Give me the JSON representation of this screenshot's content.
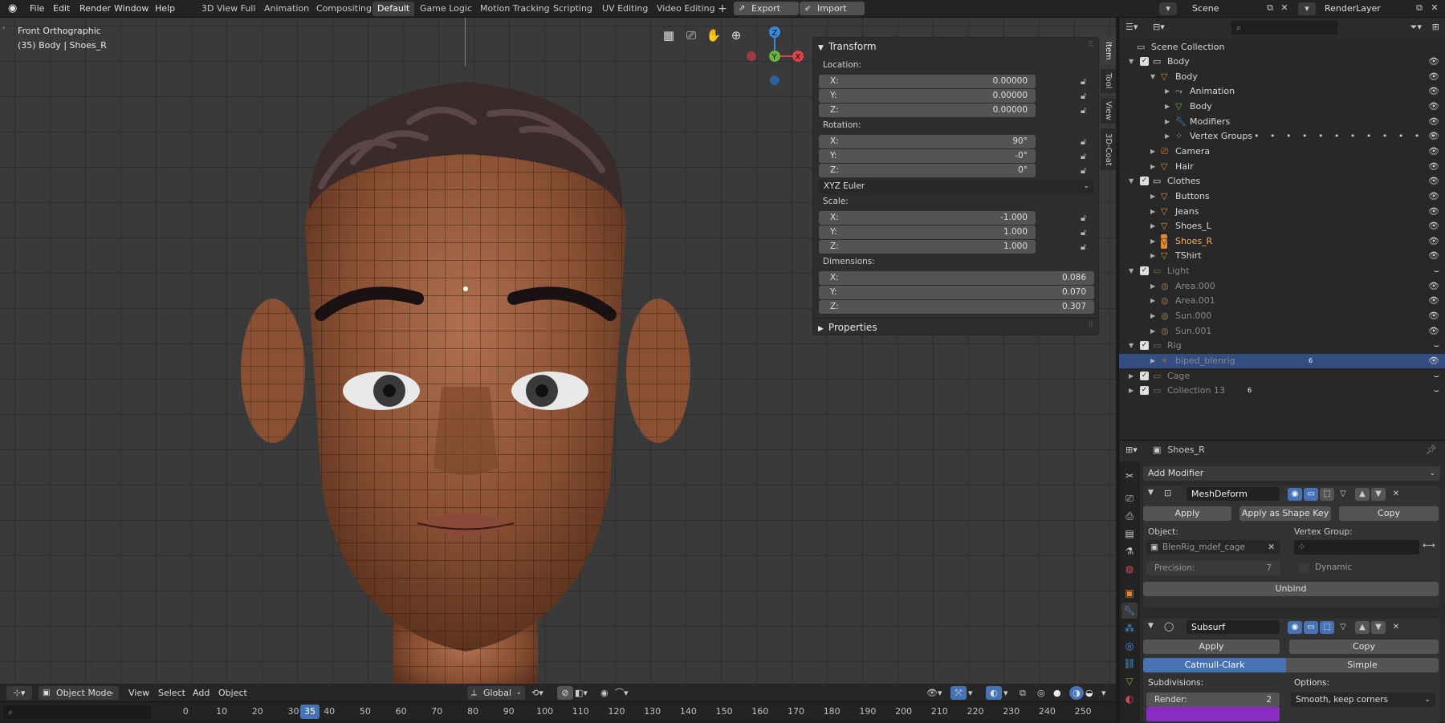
{
  "topbar": {
    "menus": [
      "File",
      "Edit",
      "Render",
      "Window",
      "Help"
    ],
    "workspaces": [
      "3D View Full",
      "Animation",
      "Compositing",
      "Default",
      "Game Logic",
      "Motion Tracking",
      "Scripting",
      "UV Editing",
      "Video Editing"
    ],
    "active_workspace": "Default",
    "add_tab": "+",
    "export_label": "Export",
    "import_label": "Import",
    "scene_name": "Scene",
    "render_layer": "RenderLayer"
  },
  "viewport": {
    "view_name": "Front Orthographic",
    "object_info": "(35) Body | Shoes_R",
    "gizmo": {
      "z": "Z",
      "y": "Y",
      "x": "X"
    },
    "accent_red": "#e0414b",
    "accent_green": "#6ab43c",
    "accent_blue": "#3a8be0"
  },
  "npanel": {
    "transform_title": "Transform",
    "location_label": "Location:",
    "location": [
      {
        "k": "X:",
        "v": "0.00000"
      },
      {
        "k": "Y:",
        "v": "0.00000"
      },
      {
        "k": "Z:",
        "v": "0.00000"
      }
    ],
    "rotation_label": "Rotation:",
    "rotation": [
      {
        "k": "X:",
        "v": "90°"
      },
      {
        "k": "Y:",
        "v": "-0°"
      },
      {
        "k": "Z:",
        "v": "0°"
      }
    ],
    "rotation_mode": "XYZ Euler",
    "scale_label": "Scale:",
    "scale": [
      {
        "k": "X:",
        "v": "-1.000"
      },
      {
        "k": "Y:",
        "v": "1.000"
      },
      {
        "k": "Z:",
        "v": "1.000"
      }
    ],
    "dimensions_label": "Dimensions:",
    "dimensions": [
      {
        "k": "X:",
        "v": "0.086"
      },
      {
        "k": "Y:",
        "v": "0.070"
      },
      {
        "k": "Z:",
        "v": "0.307"
      }
    ],
    "properties_title": "Properties",
    "tabs": [
      "Item",
      "Tool",
      "View",
      "3D-Coat"
    ]
  },
  "viewport_header": {
    "mode": "Object Mode",
    "menus": [
      "View",
      "Select",
      "Add",
      "Object"
    ],
    "orientation": "Global"
  },
  "timeline": {
    "current_frame": "35",
    "ticks": [
      "0",
      "10",
      "20",
      "30",
      "40",
      "50",
      "60",
      "70",
      "80",
      "90",
      "100",
      "110",
      "120",
      "130",
      "140",
      "150",
      "160",
      "170",
      "180",
      "190",
      "200",
      "210",
      "220",
      "230",
      "240",
      "250"
    ]
  },
  "outliner": {
    "root": "Scene Collection",
    "rows": [
      {
        "label": "Body",
        "level": 1,
        "type": "collection"
      },
      {
        "label": "Body",
        "level": 2,
        "type": "object"
      },
      {
        "label": "Animation",
        "level": 3,
        "type": "anim"
      },
      {
        "label": "Body",
        "level": 3,
        "type": "mesh"
      },
      {
        "label": "Modifiers",
        "level": 3,
        "type": "mod"
      },
      {
        "label": "Vertex Groups",
        "level": 3,
        "type": "vg"
      },
      {
        "label": "Camera",
        "level": 2,
        "type": "camera"
      },
      {
        "label": "Hair",
        "level": 2,
        "type": "object"
      },
      {
        "label": "Clothes",
        "level": 1,
        "type": "collection"
      },
      {
        "label": "Buttons",
        "level": 2,
        "type": "object"
      },
      {
        "label": "Jeans",
        "level": 2,
        "type": "object"
      },
      {
        "label": "Shoes_L",
        "level": 2,
        "type": "object"
      },
      {
        "label": "Shoes_R",
        "level": 2,
        "type": "object",
        "active": true
      },
      {
        "label": "TShirt",
        "level": 2,
        "type": "object"
      },
      {
        "label": "Light",
        "level": 1,
        "type": "collection",
        "dim": true
      },
      {
        "label": "Area.000",
        "level": 2,
        "type": "light",
        "dim": true
      },
      {
        "label": "Area.001",
        "level": 2,
        "type": "light",
        "dim": true
      },
      {
        "label": "Sun.000",
        "level": 2,
        "type": "light",
        "dim": true
      },
      {
        "label": "Sun.001",
        "level": 2,
        "type": "light",
        "dim": true
      },
      {
        "label": "Rig",
        "level": 1,
        "type": "collection",
        "dim": true
      },
      {
        "label": "biped_blenrig",
        "level": 2,
        "type": "armature",
        "dim": true,
        "selected": true
      },
      {
        "label": "Cage",
        "level": 1,
        "type": "collection",
        "dim": true
      },
      {
        "label": "Collection 13",
        "level": 1,
        "type": "collection",
        "dim": true
      }
    ],
    "badge_count": "6"
  },
  "properties": {
    "object_name": "Shoes_R",
    "add_modifier": "Add Modifier",
    "mod1": {
      "name": "MeshDeform",
      "apply": "Apply",
      "apply_shape": "Apply as Shape Key",
      "copy": "Copy",
      "object_label": "Object:",
      "object_value": "BlenRig_mdef_cage",
      "vgroup_label": "Vertex Group:",
      "precision_label": "Precision:",
      "precision_value": "7",
      "dynamic_label": "Dynamic",
      "unbind": "Unbind"
    },
    "mod2": {
      "name": "Subsurf",
      "apply": "Apply",
      "copy": "Copy",
      "catmull": "Catmull-Clark",
      "simple": "Simple",
      "subdivisions_label": "Subdivisions:",
      "render_label": "Render:",
      "render_value": "2",
      "options_label": "Options:",
      "options_value": "Smooth, keep corners"
    }
  }
}
